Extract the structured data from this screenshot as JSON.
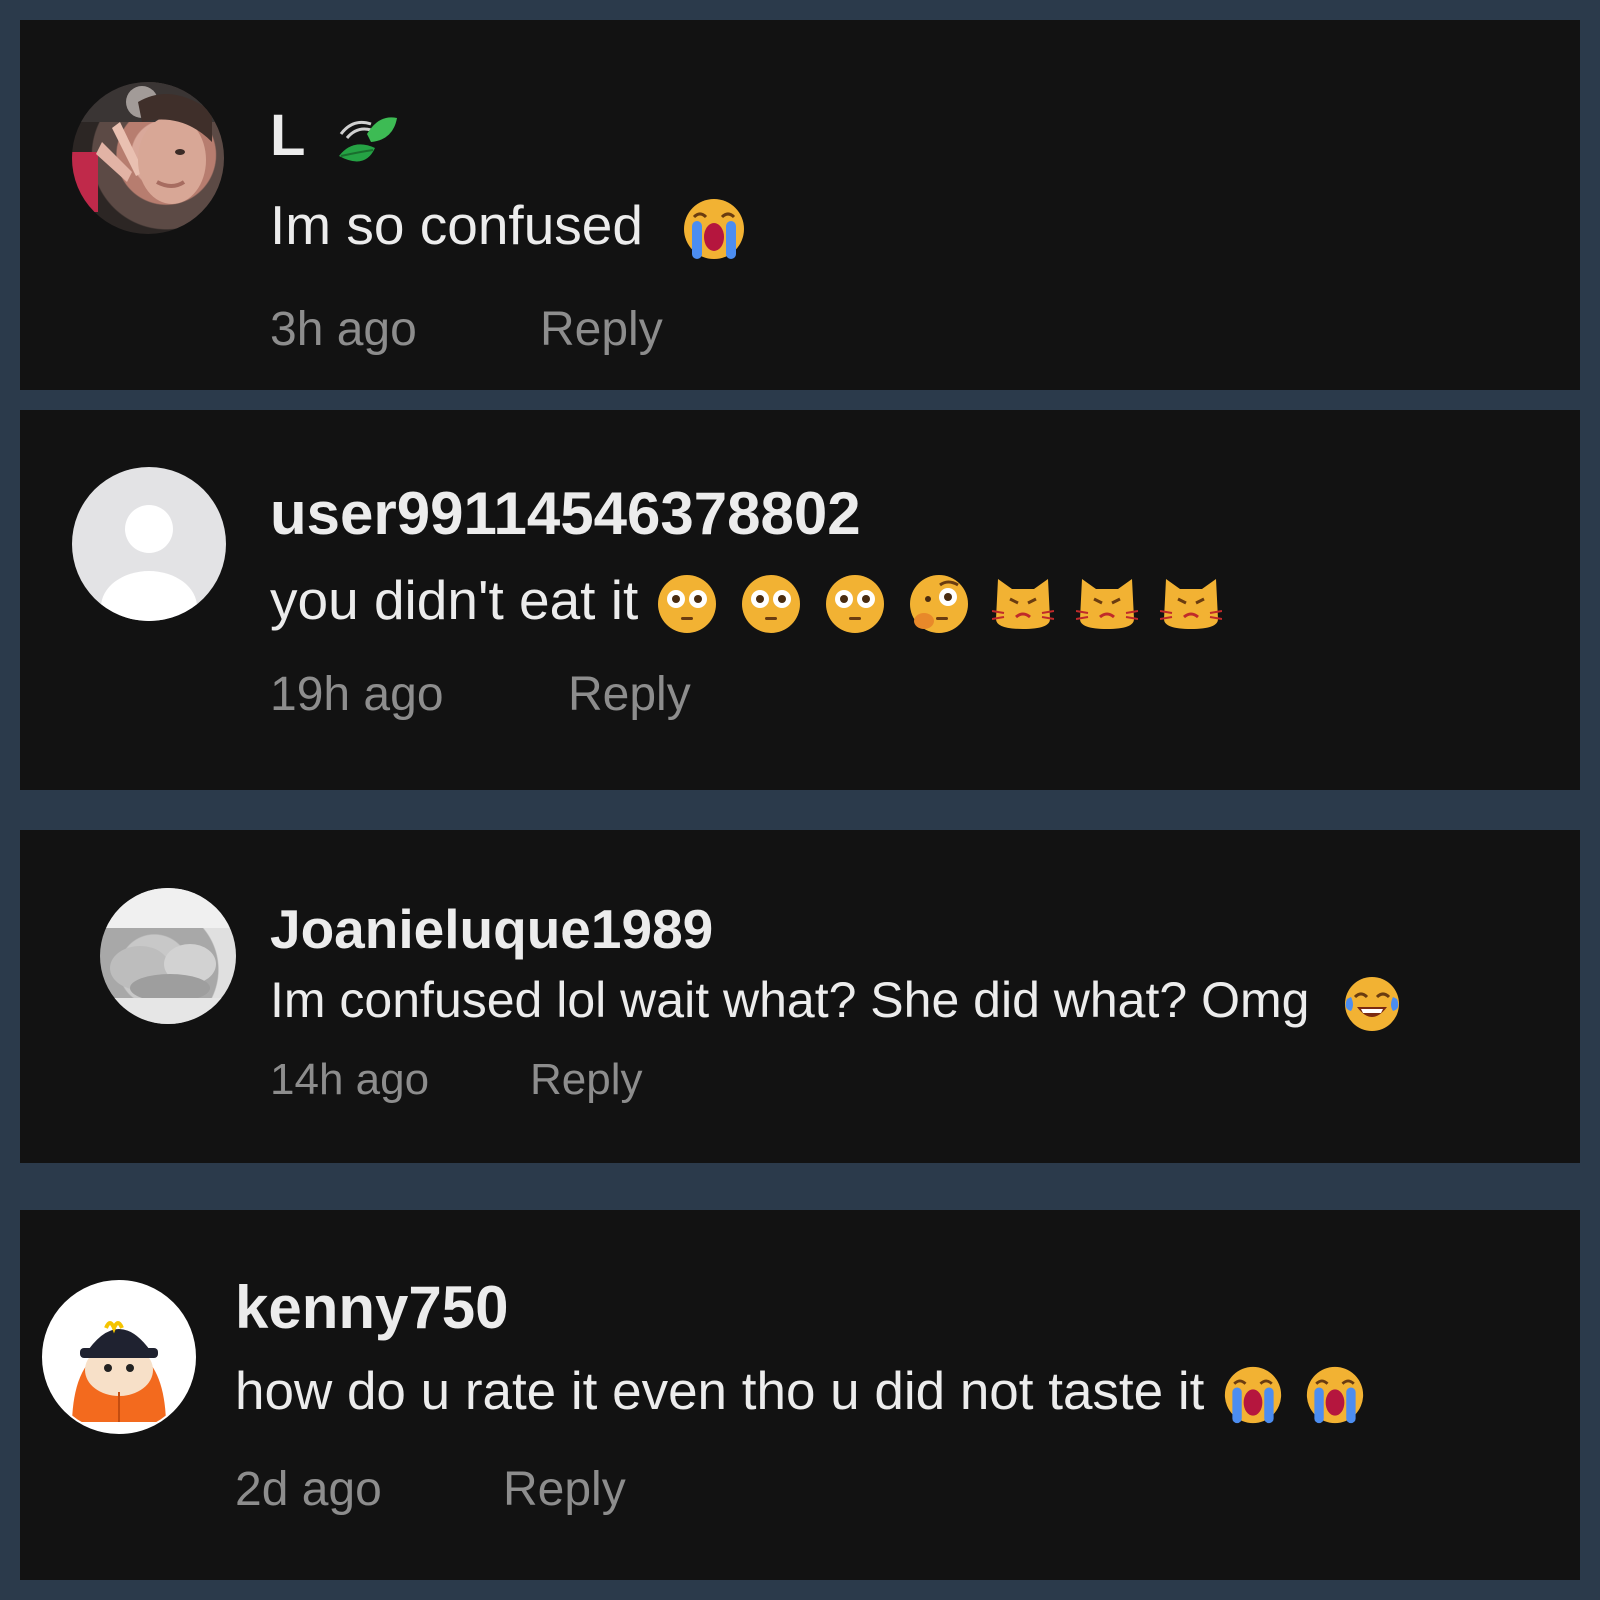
{
  "comments": [
    {
      "username": "L",
      "username_icon": "leaf-icon",
      "text": "Im so confused",
      "emojis": [
        "loudly-crying-face-icon"
      ],
      "time": "3h ago",
      "reply_label": "Reply",
      "avatar": "photo"
    },
    {
      "username": "user9911454637880​2",
      "text": "you didn't eat it",
      "emojis": [
        "flushed-face-icon",
        "flushed-face-icon",
        "flushed-face-icon",
        "face-with-raised-eyebrow-icon",
        "pouting-cat-icon",
        "pouting-cat-icon",
        "pouting-cat-icon"
      ],
      "time": "19h ago",
      "reply_label": "Reply",
      "avatar": "default"
    },
    {
      "username": "Joanieluque1989",
      "text": "Im confused lol wait what? She did what? Omg",
      "emojis": [
        "face-with-tears-of-joy-icon"
      ],
      "time": "14h ago",
      "reply_label": "Reply",
      "avatar": "photo-grayscale"
    },
    {
      "username": "kenny750",
      "text": "how do u rate it even tho u did not taste it",
      "emojis": [
        "loudly-crying-face-icon",
        "loudly-crying-face-icon"
      ],
      "time": "2d ago",
      "reply_label": "Reply",
      "avatar": "cartoon-character-with-cap"
    }
  ]
}
